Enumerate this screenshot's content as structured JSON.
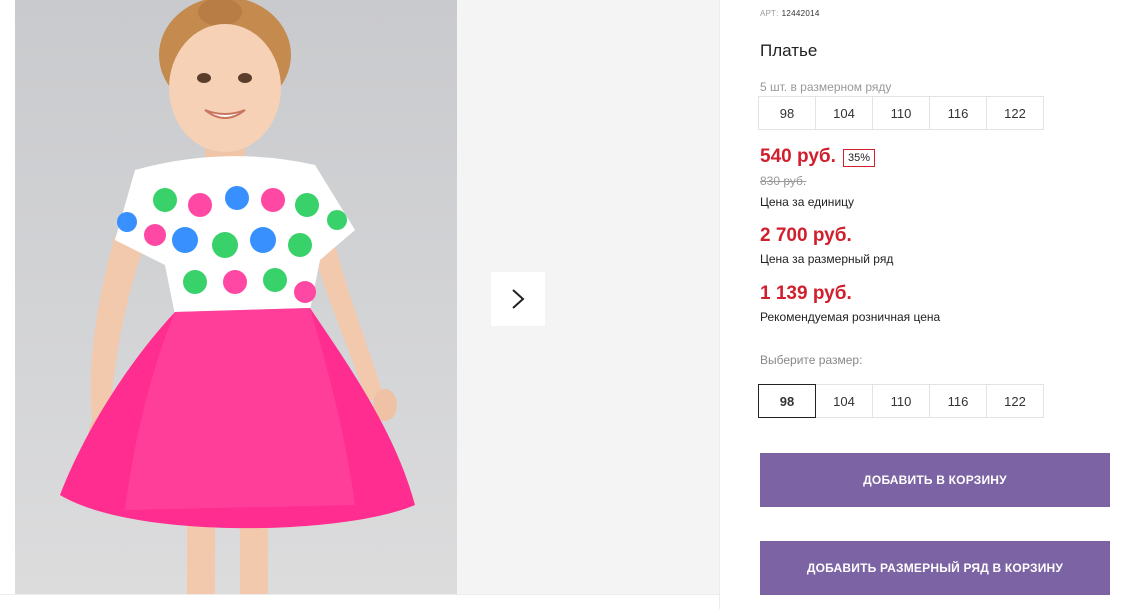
{
  "product": {
    "sku_label": "АРТ:",
    "sku": "12442014",
    "title": "Платье",
    "pack_label": "5 шт. в размерном ряду",
    "pack_sizes": [
      "98",
      "104",
      "110",
      "116",
      "122"
    ],
    "price": "540 руб.",
    "discount": "35%",
    "old_price": "830 руб.",
    "unit_price_label": "Цена за единицу",
    "pack_price": "2 700 руб.",
    "pack_price_label": "Цена за размерный ряд",
    "retail_price": "1 139 руб.",
    "retail_price_label": "Рекомендуемая розничная цена",
    "choose_size_label": "Выберите размер:",
    "sizes": [
      "98",
      "104",
      "110",
      "116",
      "122"
    ],
    "selected_size": "98",
    "add_to_cart": "ДОБАВИТЬ В КОРЗИНУ",
    "add_pack_to_cart": "ДОБАВИТЬ РАЗМЕРНЫЙ РЯД В КОРЗИНУ"
  },
  "colors": {
    "price_red": "#d0202e",
    "button_purple": "#7c63a3",
    "dress_pink": "#ff2d8f"
  },
  "gallery": {
    "next_icon": "chevron-right-icon"
  }
}
